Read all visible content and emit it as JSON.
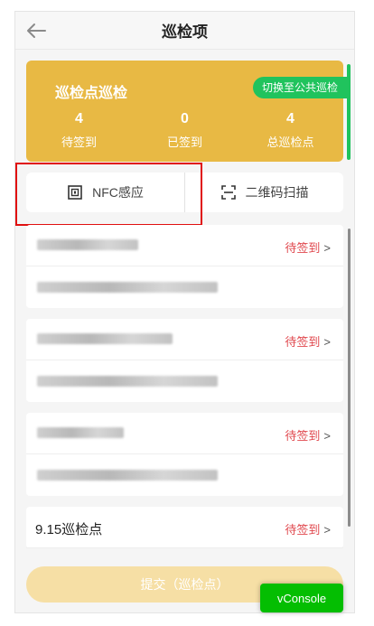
{
  "header": {
    "title": "巡检项"
  },
  "summary": {
    "title": "巡检点巡检",
    "switch_label": "切换至公共巡检",
    "stats": [
      {
        "value": "4",
        "label": "待签到"
      },
      {
        "value": "0",
        "label": "已签到"
      },
      {
        "value": "4",
        "label": "总巡检点"
      }
    ]
  },
  "tabs": [
    {
      "label": "NFC感应",
      "icon": "nfc-icon"
    },
    {
      "label": "二维码扫描",
      "icon": "scan-icon"
    }
  ],
  "items": [
    {
      "status": "待签到",
      "chevron": ">"
    },
    {
      "status": "待签到",
      "chevron": ">"
    },
    {
      "status": "待签到",
      "chevron": ">"
    },
    {
      "name": "9.15巡检点",
      "status": "待签到",
      "chevron": ">"
    }
  ],
  "submit_label": "提交（巡检点）",
  "vconsole_label": "vConsole",
  "colors": {
    "summary_bg": "#e8b944",
    "accent_green": "#20c35d",
    "status_red": "#e0484e"
  }
}
